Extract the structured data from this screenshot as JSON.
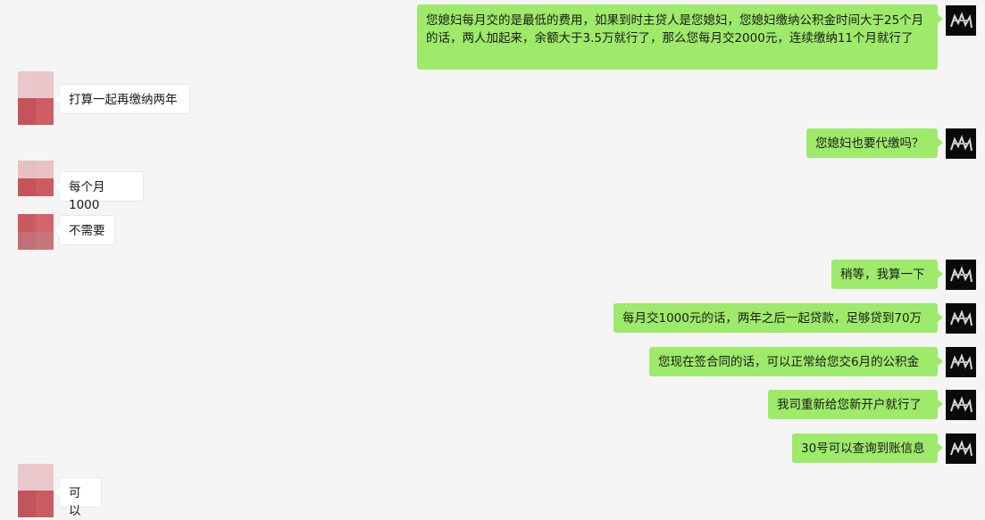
{
  "chat": {
    "messages": [
      {
        "side": "out",
        "text": "您媳妇每月交的是最低的费用，如果到时主贷人是您媳妇，您媳妇缴纳公积金时间大于25个月的话，两人加起来，余额大于3.5万就行了，那么您每月交2000元，连续缴纳11个月就行了"
      },
      {
        "side": "in",
        "text": "打算一起再缴纳两年"
      },
      {
        "side": "out",
        "text": "您媳妇也要代缴吗？"
      },
      {
        "side": "in",
        "text": "每个月1000"
      },
      {
        "side": "in",
        "text": "不需要"
      },
      {
        "side": "out",
        "text": "稍等，我算一下"
      },
      {
        "side": "out",
        "text": "每月交1000元的话，两年之后一起贷款，足够贷到70万"
      },
      {
        "side": "out",
        "text": "您现在签合同的话，可以正常给您交6月的公积金"
      },
      {
        "side": "out",
        "text": "我司重新给您新开户就行了"
      },
      {
        "side": "out",
        "text": "30号可以查询到账信息"
      },
      {
        "side": "in",
        "text": "可以"
      }
    ]
  },
  "colors": {
    "outgoing_bubble": "#9eea6a",
    "incoming_bubble": "#ffffff",
    "background": "#f5f5f5"
  },
  "icons": {
    "self_avatar": "self-avatar-icon",
    "contact_avatar": "contact-avatar-icon"
  }
}
